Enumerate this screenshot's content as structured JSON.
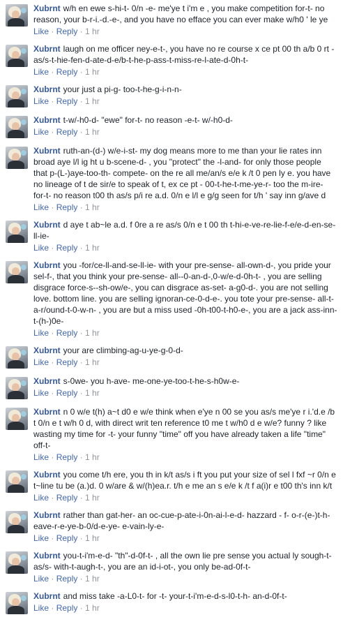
{
  "comments": [
    {
      "author": "Xubrnt",
      "text": "w/h en ewe s-hi-t- 0/n -e- me'ye t i'm e , you make competition for-t- no reason, your b-r-i.-d.-e-, and you have no efface you can ever make w/h0 ' le ye",
      "like": "Like",
      "reply": "Reply",
      "time": "1 hr"
    },
    {
      "author": "Xubrnt",
      "text": "laugh on me officer ney-e-t-, you have no re course x ce pt 00 th a/b 0 rt - as/s-t-hie-fen-d-ate-d-e/b-t-he-p-ass-t-miss-re-l-ate-d-0h-t-",
      "like": "Like",
      "reply": "Reply",
      "time": "1 hr"
    },
    {
      "author": "Xubrnt",
      "text": "your just a pi-g- too-t-he-g-i-n-n-",
      "like": "Like",
      "reply": "Reply",
      "time": "1 hr"
    },
    {
      "author": "Xubrnt",
      "text": "t-w/-h0-d- \"ewe\" for-t- no reason -e-t- w/-h0-d-",
      "like": "Like",
      "reply": "Reply",
      "time": "1 hr"
    },
    {
      "author": "Xubrnt",
      "text": "ruth-an-(d-) w/e-i-st- my dog means more to me than your lie rates inn broad aye l/l ig ht u b-scene-d- , you \"protect\" the -l-and- for only those people that p-(L-)aye-too-th- compete- on the re all me/an/s e/e k /t 0 pen ly e. you have no lineage of t de sir/e to speak of t, ex ce pt - 00-t-he-t-me-ye-r- too the m-ire- for-t- no reason t00 th as/s p/i re a.d. 0/n e l/l e g/g seen for t/h ' say inn g/ave d",
      "like": "Like",
      "reply": "Reply",
      "time": "1 hr"
    },
    {
      "author": "Xubrnt",
      "text": "d aye t ab~le a.d. f 0re a re as/s 0/n e t 00 th t-hi-e-ve-re-lie-f-e/e-d-en-se-ll-ie-",
      "like": "Like",
      "reply": "Reply",
      "time": "1 hr"
    },
    {
      "author": "Xubrnt",
      "text": "you -for/ce-ll-and-se-ll-ie- with your pre-sense- all-own-d-, you pride your sel-f-, that you think your pre-sense- all--0-an-d-,0-w/e-d-0h-t- , you are selling disgrace force-s--sh-ow/e-, you can disgrace as-set- a-g0-d-. you are not selling love. bottom line. you are selling ignoran-ce-0-d-e-. you tote your pre-sense- all-t-a-r/ound-t-0-w-n- , you are but a miss used -0h-t00-t-h0-e-, you are a jack ass-inn-t-(h-)0e-",
      "like": "Like",
      "reply": "Reply",
      "time": "1 hr"
    },
    {
      "author": "Xubrnt",
      "text": "your are climbing-ag-u-ye-g-0-d-",
      "like": "Like",
      "reply": "Reply",
      "time": "1 hr"
    },
    {
      "author": "Xubrnt",
      "text": "s-0we- you h-ave- me-one-ye-too-t-he-s-h0w-e-",
      "like": "Like",
      "reply": "Reply",
      "time": "1 hr"
    },
    {
      "author": "Xubrnt",
      "text": "n 0 w/e t(h) a~t d0 e w/e think when e'ye n 00 se you as/s me'ye r i.'d.e /b t 0/n e t w/h 0 d, with direct writ ten reference t0 me t w/h0 d e w/e? funny ? like wasting my time for -t- your funny \"time\" off you have already taken a life \"time\" off-t-",
      "like": "Like",
      "reply": "Reply",
      "time": "1 hr"
    },
    {
      "author": "Xubrnt",
      "text": "you come t/h ere, you th in k/t as/s i ft you put your size of sel l fxf ~r 0/n e t~line tu be (a.)d. 0 w/are & w/(h)ea.r. t/h e me an s e/e k /t f a(i)r e t00 th's inn k/t",
      "like": "Like",
      "reply": "Reply",
      "time": "1 hr"
    },
    {
      "author": "Xubrnt",
      "text": "rather than gat-her- an oc-cue-p-ate-i-0n-ai-l-e-d- hazzard - f- o-r-(e-)t-h-eave-r-e-ye-b-0/d-e-ye- e-vain-ly-e-",
      "like": "Like",
      "reply": "Reply",
      "time": "1 hr"
    },
    {
      "author": "Xubrnt",
      "text": "you-t-i'm-e-d- \"th\"-d-0f-t- , all the own lie pre sense you actual ly sough-t- as/s- with-t-augh-t-, you are an id-i-ot-, you only be-ad-0f-t-",
      "like": "Like",
      "reply": "Reply",
      "time": "1 hr"
    },
    {
      "author": "Xubrnt",
      "text": "and miss take -a-L0-t- for -t- your-t-i'm-e-d-s-l0-t-h- an-d-0f-t-",
      "like": "Like",
      "reply": "Reply",
      "time": "1 hr"
    }
  ]
}
